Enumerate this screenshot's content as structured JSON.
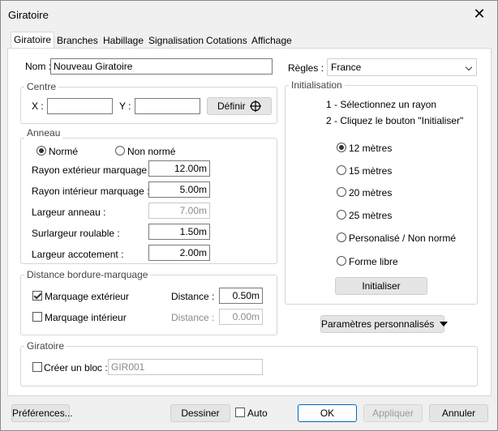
{
  "window": {
    "title": "Giratoire",
    "close_glyph": "✕"
  },
  "tabs": [
    {
      "label": "Giratoire",
      "active": true
    },
    {
      "label": "Branches"
    },
    {
      "label": "Habillage"
    },
    {
      "label": "Signalisation"
    },
    {
      "label": "Cotations"
    },
    {
      "label": "Affichage"
    }
  ],
  "nom": {
    "label": "Nom :",
    "value": "Nouveau Giratoire"
  },
  "regles": {
    "label": "Règles :",
    "value": "France"
  },
  "centre": {
    "title": "Centre",
    "x_label": "X :",
    "x_value": "",
    "y_label": "Y :",
    "y_value": "",
    "definir_label": "Définir"
  },
  "anneau": {
    "title": "Anneau",
    "radio_norme": "Normé",
    "radio_non_norme": "Non normé",
    "fields": [
      {
        "label": "Rayon extérieur marquage :",
        "value": "12.00m",
        "disabled": false
      },
      {
        "label": "Rayon intérieur marquage :",
        "value": "5.00m",
        "disabled": false
      },
      {
        "label": "Largeur anneau :",
        "value": "7.00m",
        "disabled": true
      },
      {
        "label": "Surlargeur roulable :",
        "value": "1.50m",
        "disabled": false
      },
      {
        "label": "Largeur accotement :",
        "value": "2.00m",
        "disabled": false
      }
    ]
  },
  "distance": {
    "title": "Distance bordure-marquage",
    "ext_label": "Marquage extérieur",
    "ext_checked": true,
    "ext_dist_label": "Distance :",
    "ext_dist_value": "0.50m",
    "int_label": "Marquage intérieur",
    "int_checked": false,
    "int_dist_label": "Distance :",
    "int_dist_value": "0.00m"
  },
  "initialisation": {
    "title": "Initialisation",
    "step1": "1 - Sélectionnez un rayon",
    "step2": "2 - Cliquez le bouton \"Initialiser\"",
    "options": [
      {
        "label": "12 mètres",
        "checked": true
      },
      {
        "label": "15 mètres"
      },
      {
        "label": "20 mètres"
      },
      {
        "label": "25 mètres"
      },
      {
        "label": "Personalisé / Non normé"
      },
      {
        "label": "Forme libre"
      }
    ],
    "button": "Initialiser"
  },
  "parametres_button": "Paramètres personnalisés",
  "giratoire": {
    "title": "Giratoire",
    "creer_label": "Créer un bloc :",
    "creer_checked": false,
    "bloc_value": "GIR001"
  },
  "footer": {
    "preferences": "Préférences...",
    "dessiner": "Dessiner",
    "auto": "Auto",
    "ok": "OK",
    "appliquer": "Appliquer",
    "annuler": "Annuler"
  }
}
